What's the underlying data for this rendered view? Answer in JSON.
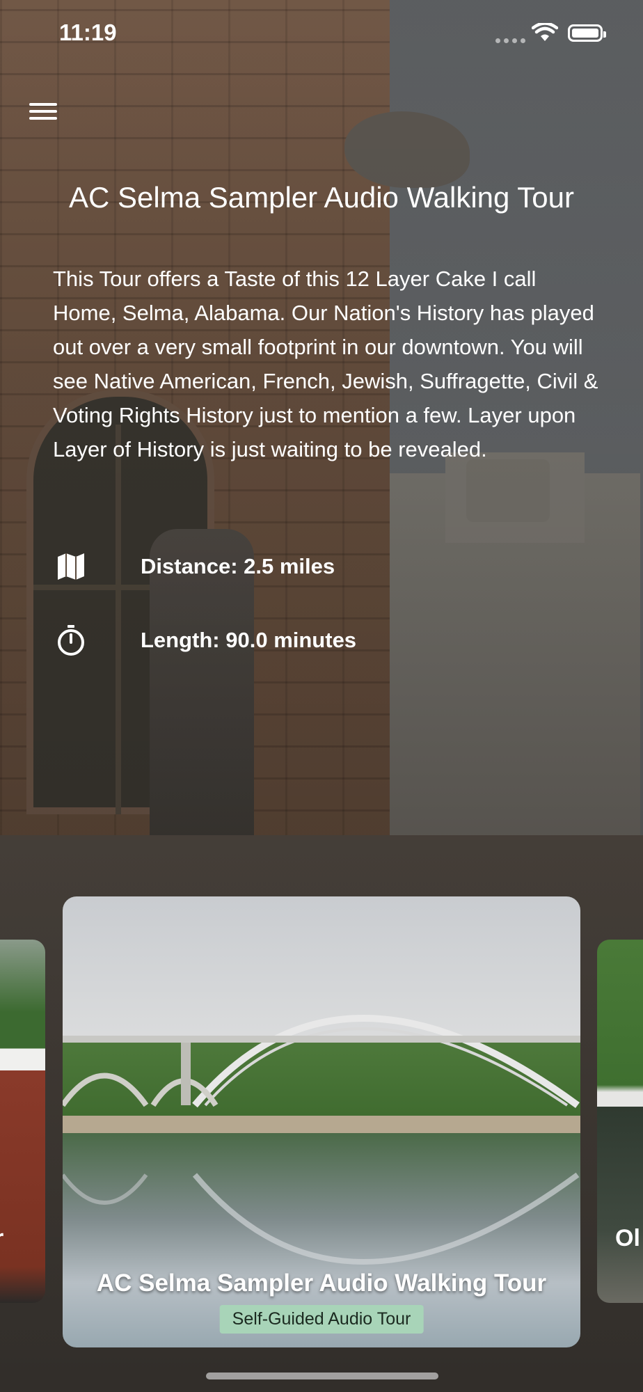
{
  "status_bar": {
    "time": "11:19"
  },
  "header": {
    "menu_icon": "hamburger-menu-icon"
  },
  "tour": {
    "title": "AC Selma Sampler Audio Walking Tour",
    "description": "This Tour offers a Taste of this 12 Layer Cake I call Home, Selma, Alabama. Our Nation's History has played out over a very small footprint in our downtown. You will see Native American, French, Jewish, Suffragette, Civil & Voting Rights History just to mention a few. Layer upon Layer of History is just waiting to be revealed.",
    "distance": "Distance: 2.5 miles",
    "length": "Length: 90.0 minutes",
    "distance_icon": "map-icon",
    "length_icon": "stopwatch-icon"
  },
  "carousel": {
    "left_partial_text": "r",
    "right_partial_text": "Ol",
    "active_card": {
      "title": "AC Selma Sampler Audio Walking Tour",
      "badge": "Self-Guided Audio Tour"
    }
  },
  "colors": {
    "badge_bg": "#a8d4b8",
    "text": "#ffffff"
  }
}
